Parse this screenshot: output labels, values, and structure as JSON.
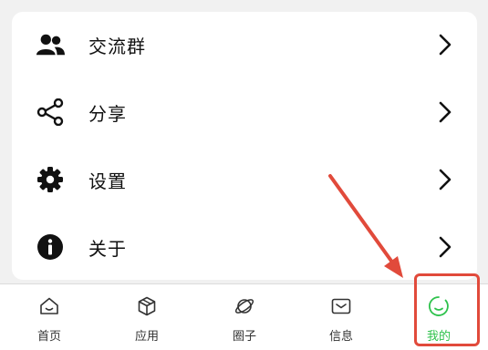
{
  "menu": {
    "items": [
      {
        "label": "交流群",
        "icon": "users-icon"
      },
      {
        "label": "分享",
        "icon": "share-icon"
      },
      {
        "label": "设置",
        "icon": "gear-icon"
      },
      {
        "label": "关于",
        "icon": "info-icon"
      }
    ]
  },
  "tabbar": {
    "tabs": [
      {
        "label": "首页",
        "icon": "home-icon"
      },
      {
        "label": "应用",
        "icon": "box-icon"
      },
      {
        "label": "圈子",
        "icon": "planet-icon"
      },
      {
        "label": "信息",
        "icon": "mail-icon"
      },
      {
        "label": "我的",
        "icon": "smile-icon"
      }
    ],
    "active_index": 4,
    "active_color": "#2ec24c"
  },
  "annotation": {
    "highlight_color": "#e14a3b"
  }
}
